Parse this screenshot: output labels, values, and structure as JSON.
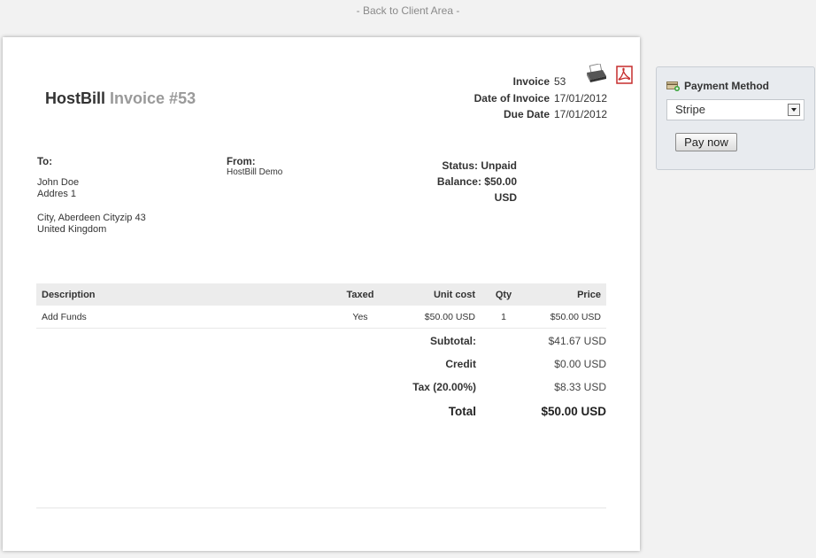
{
  "back_link": "- Back to Client Area -",
  "icons": {
    "print": "printer-icon",
    "pdf": "pdf-icon",
    "payment": "credit-card-icon"
  },
  "brand": {
    "name": "HostBill",
    "suffix": "Invoice #53"
  },
  "meta": {
    "invoice_label": "Invoice",
    "invoice_value": "53",
    "date_label": "Date of Invoice",
    "date_value": "17/01/2012",
    "due_label": "Due Date",
    "due_value": "17/01/2012"
  },
  "to": {
    "heading": "To:",
    "name": "John Doe",
    "address1": "Addres 1",
    "city": "City, Aberdeen Cityzip 43",
    "country": "United Kingdom"
  },
  "from": {
    "heading": "From:",
    "company": "HostBill Demo"
  },
  "status": {
    "status_label": "Status:",
    "status_value": "Unpaid",
    "balance_label": "Balance:",
    "balance_value": "$50.00 USD"
  },
  "table": {
    "headers": {
      "description": "Description",
      "taxed": "Taxed",
      "unit_cost": "Unit cost",
      "qty": "Qty",
      "price": "Price"
    },
    "rows": [
      {
        "description": "Add Funds",
        "taxed": "Yes",
        "unit_cost": "$50.00 USD",
        "qty": "1",
        "price": "$50.00 USD"
      }
    ]
  },
  "totals": {
    "subtotal_label": "Subtotal:",
    "subtotal_value": "$41.67 USD",
    "credit_label": "Credit",
    "credit_value": "$0.00 USD",
    "tax_label": "Tax (20.00%)",
    "tax_value": "$8.33 USD",
    "total_label": "Total",
    "total_value": "$50.00 USD"
  },
  "payment": {
    "title": "Payment Method",
    "selected": "Stripe",
    "button": "Pay now"
  }
}
